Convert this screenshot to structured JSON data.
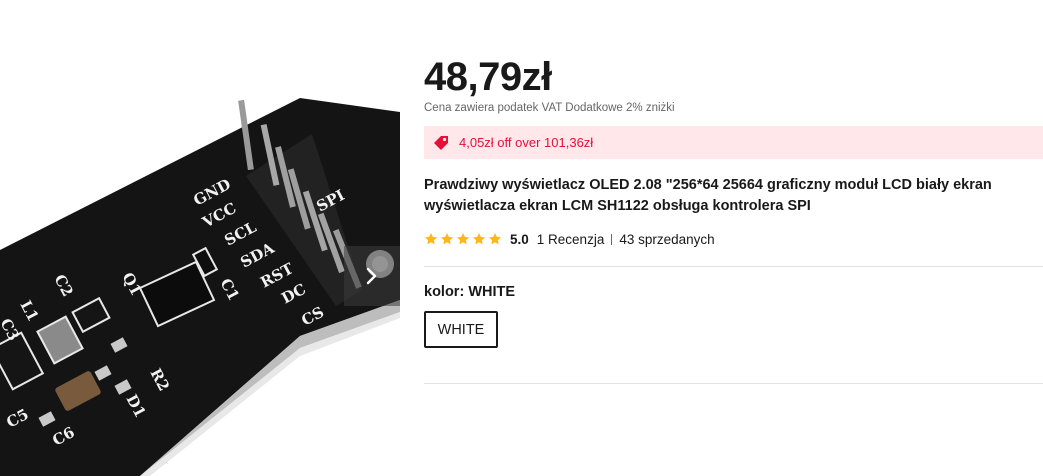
{
  "gallery": {
    "pcb_labels": [
      "GND",
      "VCC",
      "SCL",
      "SDA",
      "RST",
      "DC",
      "CS",
      "SPI",
      "Q1",
      "C1",
      "C2",
      "L1",
      "C3",
      "C5",
      "C6",
      "D1",
      "R2"
    ],
    "next_icon": "chevron-right-icon"
  },
  "product": {
    "price": "48,79zł",
    "tax_note": "Cena zawiera podatek VAT Dodatkowe 2% zniżki",
    "coupon": {
      "icon": "tag-icon",
      "text": "4,05zł off over 101,36zł"
    },
    "title": "Prawdziwy wyświetlacz OLED 2.08 \"256*64 25664 graficzny moduł LCD biały ekran wyświetlacza ekran LCM SH1122 obsługa kontrolera SPI",
    "rating": {
      "stars": 5,
      "score": "5.0",
      "reviews": "1 Recenzja",
      "sold": "43 sprzedanych"
    },
    "color": {
      "label": "kolor: ",
      "value": "WHITE",
      "options": [
        "WHITE"
      ]
    }
  },
  "colors": {
    "price": "#191919",
    "coupon_bg": "#ffe7ea",
    "coupon_text": "#e4103a",
    "star": "#fdb813",
    "pcb": "#141414"
  }
}
